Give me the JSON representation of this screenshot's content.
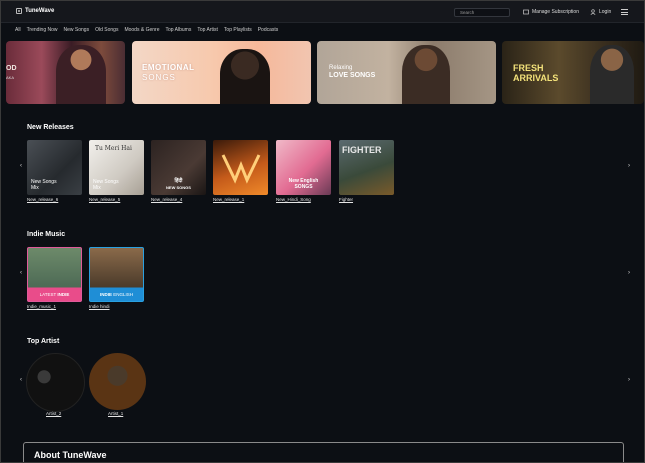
{
  "app": {
    "name": "TuneWave"
  },
  "header": {
    "search_placeholder": "Search",
    "manage_label": "Manage Subscription",
    "login_label": "Login"
  },
  "nav": [
    "All",
    "Trending Now",
    "New Songs",
    "Old Songs",
    "Moods & Genre",
    "Top Albums",
    "Top Artist",
    "Top Playlists",
    "Podcasts"
  ],
  "banners": [
    {
      "line1": "OD",
      "line2": "AKA"
    },
    {
      "line1": "EMOTIONAL",
      "line2": "SONGS"
    },
    {
      "line1": "Relaxing",
      "line2": "LOVE SONGS"
    },
    {
      "line1": "FRESH",
      "line2": "ARRIVALS"
    }
  ],
  "new_releases": {
    "title": "New Releases",
    "items": [
      {
        "label": "New_release_6",
        "cover": "New Songs\nMix"
      },
      {
        "label": "New_release_5",
        "cover": "New Songs\nMix",
        "cover_top": "Tu Meri Hai"
      },
      {
        "label": "New_release_4",
        "cover": "NEW SONGS",
        "cover_top": "हिंदी"
      },
      {
        "label": "New_release_1",
        "cover": ""
      },
      {
        "label": "New_Hindi_Song",
        "cover": "New English\nSONGS"
      },
      {
        "label": "Fighter",
        "cover": "FIGHTER"
      }
    ]
  },
  "indie": {
    "title": "Indie Music",
    "items": [
      {
        "label": "Indie_music_1",
        "band_a": "LATEST",
        "band_b": "INDIE"
      },
      {
        "label": "Indie hindi",
        "band_a": "INDIE",
        "band_b": "ENGLISH"
      }
    ]
  },
  "top_artist": {
    "title": "Top Artist",
    "items": [
      {
        "label": "Artist_2"
      },
      {
        "label": "Artist_1"
      }
    ]
  },
  "about": {
    "title": "About TuneWave"
  }
}
